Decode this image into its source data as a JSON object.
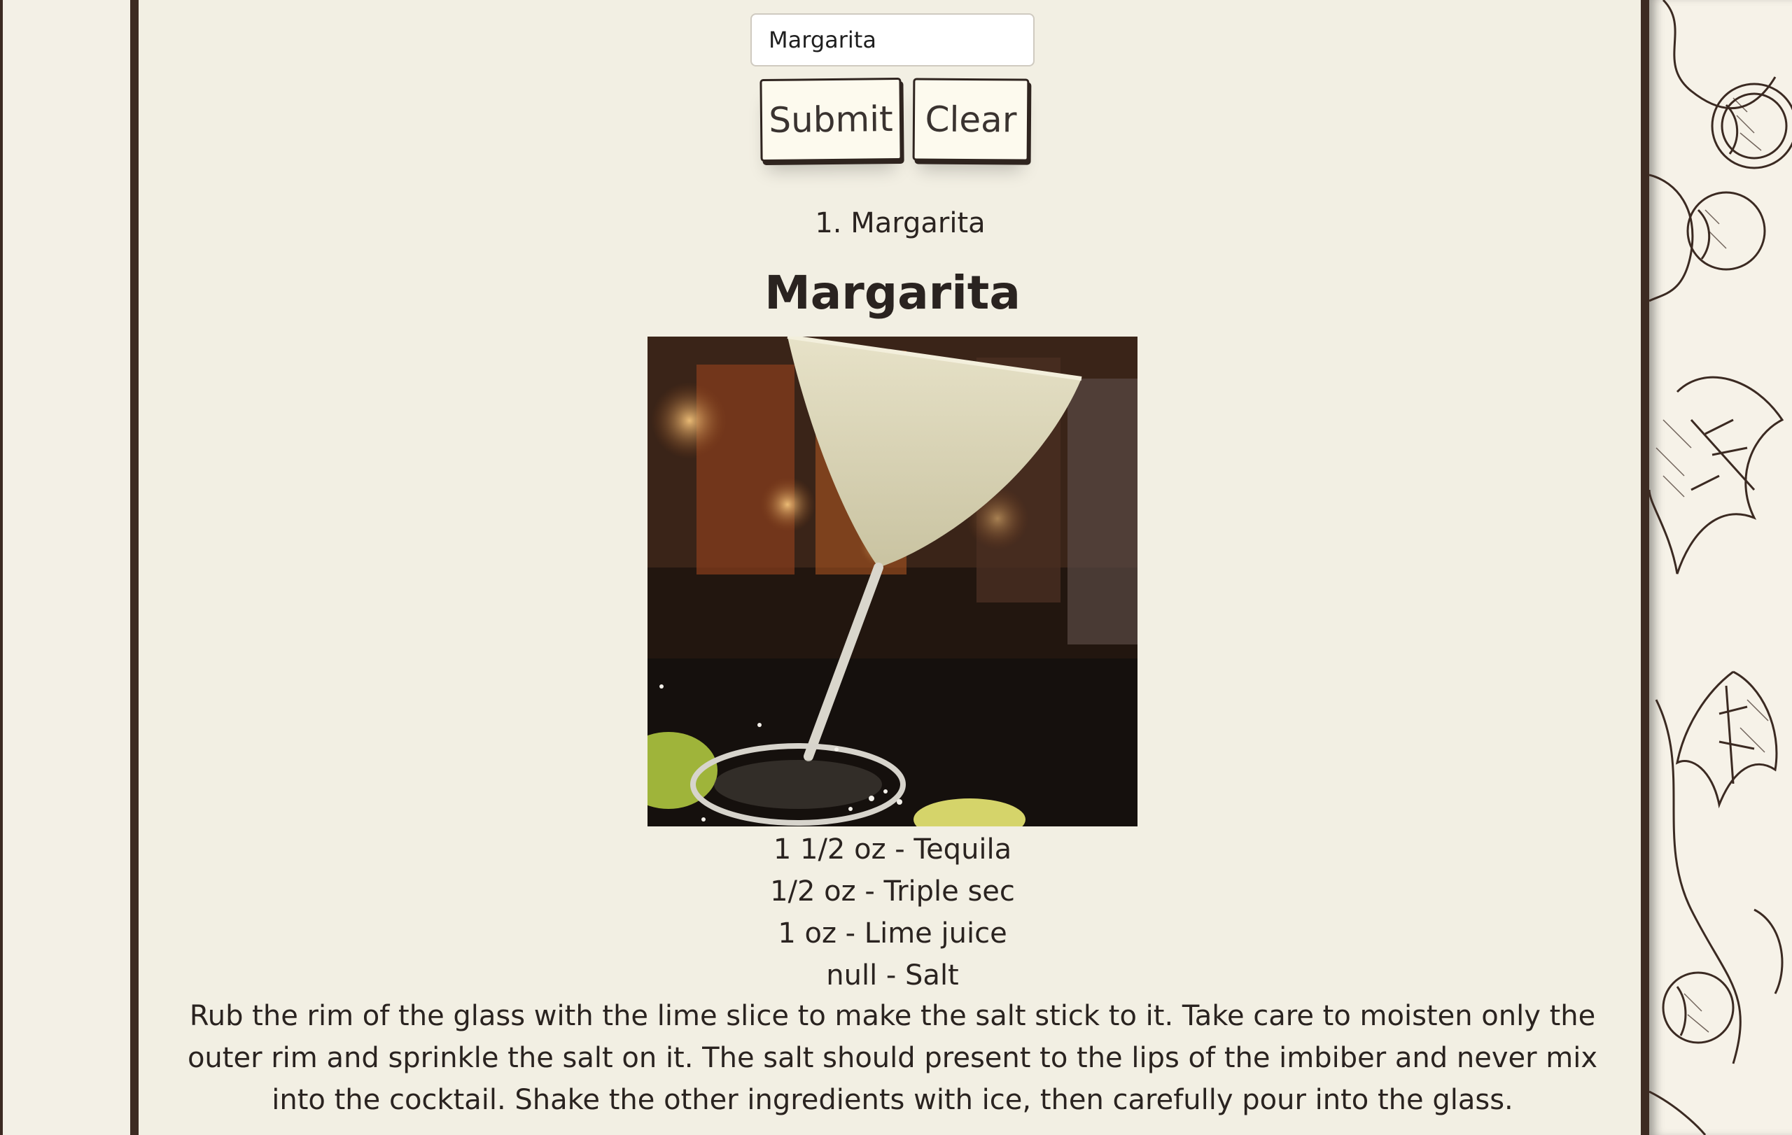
{
  "search": {
    "value": "Margarita"
  },
  "buttons": {
    "submit_label": "Submit",
    "clear_label": "Clear"
  },
  "results": [
    {
      "label": "1. Margarita"
    }
  ],
  "drink": {
    "name": "Margarita",
    "image_alt": "Margarita cocktail in a stemmed glass",
    "ingredients": [
      "1 1/2 oz - Tequila",
      "1/2 oz - Triple sec",
      "1 oz - Lime juice",
      "null - Salt"
    ],
    "instructions": "Rub the rim of the glass with the lime slice to make the salt stick to it. Take care to moisten only the outer rim and sprinkle the salt on it. The salt should present to the lips of the imbiber and never mix into the cocktail. Shake the other ingredients with ice, then carefully pour into the glass."
  },
  "theme": {
    "page_background": "#f2efe3",
    "frame_color": "#3d2b22",
    "button_background": "#fdfaee"
  }
}
